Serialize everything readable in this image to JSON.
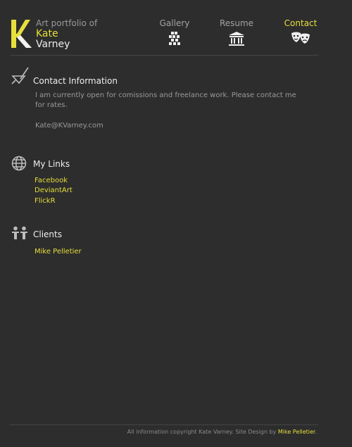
{
  "logo": {
    "monogram": "K",
    "line1": "Art portfolio of",
    "line2": "Kate",
    "line3": "Varney"
  },
  "nav": {
    "gallery": {
      "label": "Gallery",
      "icon": "gallery-icon"
    },
    "resume": {
      "label": "Resume",
      "icon": "building-icon"
    },
    "contact": {
      "label": "Contact",
      "icon": "theater-masks-icon",
      "active": true
    }
  },
  "contact_section": {
    "title": "Contact Information",
    "text": "I am currently open for comissions and freelance work. Please contact me for rates.",
    "email": "Kate@KVarney.com"
  },
  "links_section": {
    "title": "My Links",
    "links": [
      "Facebook",
      "DeviantArt",
      "FlickR"
    ]
  },
  "clients_section": {
    "title": "Clients",
    "clients": [
      "Mike Pelletier"
    ]
  },
  "footer": {
    "text": "All information copyright Kate Varney. Site Design by",
    "designer": "Mike Pelletier",
    "end": "."
  },
  "colors": {
    "background": "#2d2d2d",
    "accent": "#e6df3c",
    "muted": "#9a9a9a"
  }
}
